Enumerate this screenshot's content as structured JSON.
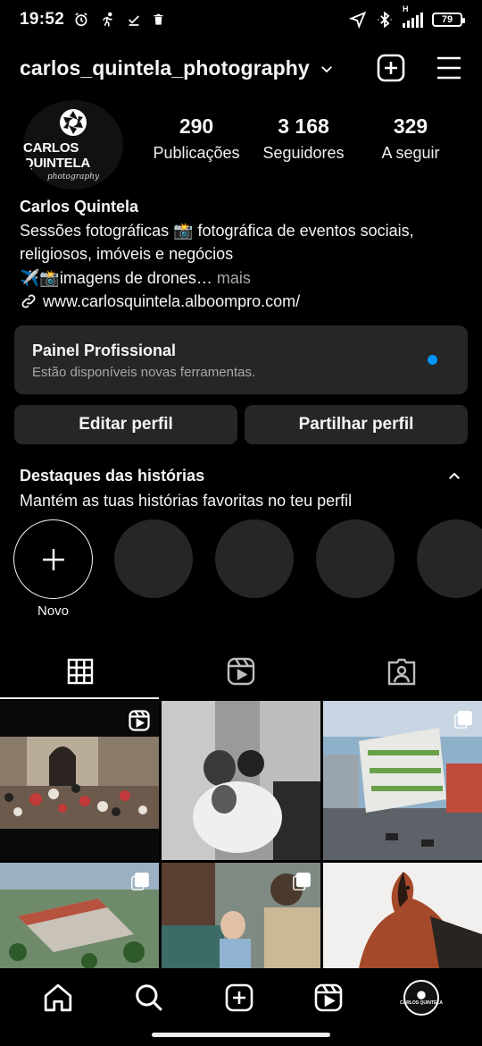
{
  "status_bar": {
    "time": "19:52",
    "left_icons": [
      "alarm-icon",
      "running-icon",
      "download-done-icon",
      "trash-icon"
    ],
    "right_icons": [
      "location-icon",
      "bluetooth-icon",
      "signal-icon"
    ],
    "network": "H",
    "battery": "79"
  },
  "header": {
    "username": "carlos_quintela_photography",
    "icons": [
      "chevron-down-icon",
      "new-post-icon",
      "menu-icon"
    ]
  },
  "profile": {
    "avatar_logo_text": "CARLOS QUINTELA",
    "avatar_logo_sub": "photography",
    "stats": [
      {
        "value": "290",
        "label": "Publicações"
      },
      {
        "value": "3 168",
        "label": "Seguidores"
      },
      {
        "value": "329",
        "label": "A seguir"
      }
    ],
    "name": "Carlos Quintela",
    "bio_line1": "Sessões fotográficas 📸 fotográfica de eventos sociais,",
    "bio_line2": "religiosos, imóveis e negócios",
    "bio_line3": "✈️📸imagens de drones…",
    "bio_more": " mais",
    "website": "www.carlosquintela.alboompro.com/"
  },
  "pro_panel": {
    "title": "Painel Profissional",
    "subtitle": "Estão disponíveis novas ferramentas."
  },
  "buttons": {
    "edit": "Editar perfil",
    "share": "Partilhar perfil"
  },
  "highlights": {
    "title": "Destaques das histórias",
    "subtitle": "Mantém as tuas histórias favoritas no teu perfil",
    "new_label": "Novo",
    "placeholders": 4
  },
  "tabs": [
    "grid-icon",
    "reels-icon",
    "tagged-icon"
  ],
  "grid_posts": [
    {
      "kind": "reel",
      "desc": "wedding crowd"
    },
    {
      "kind": "photo",
      "desc": "baptism bw"
    },
    {
      "kind": "carousel",
      "desc": "building aerial"
    },
    {
      "kind": "carousel",
      "desc": "aerial estate"
    },
    {
      "kind": "carousel",
      "desc": "family baby"
    },
    {
      "kind": "photo",
      "desc": "horse"
    }
  ],
  "bottom_nav": [
    "home-icon",
    "search-icon",
    "create-icon",
    "reels-icon",
    "profile-avatar"
  ],
  "colors": {
    "background": "#000000",
    "surface": "#262626",
    "accent_blue": "#0095f6",
    "muted_text": "#a8a8a8"
  }
}
